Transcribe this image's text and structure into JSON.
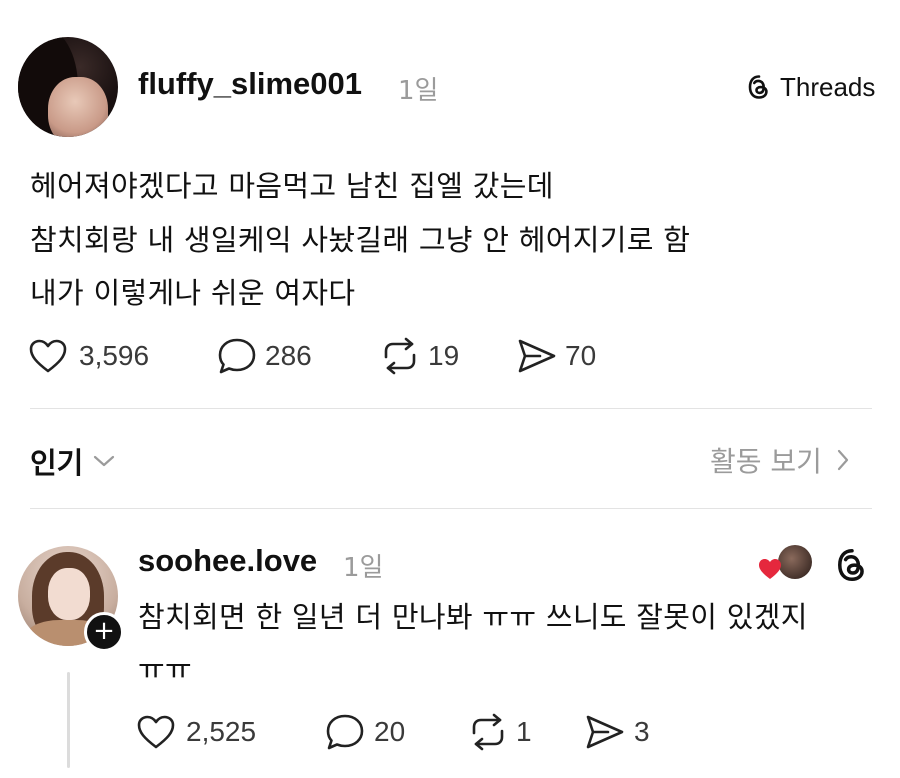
{
  "post": {
    "username": "fluffy_slime001",
    "time": "1일",
    "platform_label": "Threads",
    "lines": [
      "헤어져야겠다고 마음먹고 남친 집엘 갔는데",
      "참치회랑 내 생일케익 사놨길래 그냥 안 헤어지기로 함",
      "내가 이렇게나 쉬운 여자다"
    ],
    "stats": {
      "likes": "3,596",
      "replies": "286",
      "reposts": "19",
      "shares": "70"
    }
  },
  "replies_header": {
    "sort_label": "인기",
    "activity_label": "활동 보기"
  },
  "reply": {
    "username": "soohee.love",
    "time": "1일",
    "lines": [
      "참치회면 한 일년 더 만나봐 ㅠㅠ 쓰니도 잘못이 있겠지",
      "ㅠㅠ"
    ],
    "stats": {
      "likes": "2,525",
      "replies": "20",
      "reposts": "1",
      "shares": "3"
    }
  },
  "colors": {
    "text": "#111111",
    "muted": "#9b9b9b",
    "heart": "#e5283d",
    "divider": "#e3e3e3"
  },
  "icons": {
    "like": "heart-outline-icon",
    "reply": "speech-bubble-icon",
    "repost": "repost-arrows-icon",
    "share": "paper-plane-icon",
    "platform": "threads-logo-icon",
    "sort": "chevron-down-icon",
    "activity": "chevron-right-icon"
  }
}
